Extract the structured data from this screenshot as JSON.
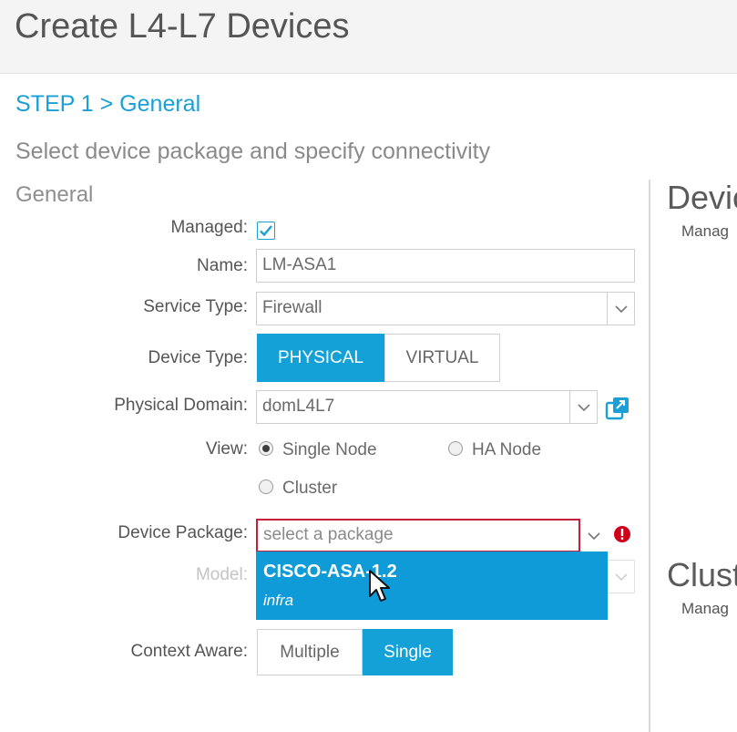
{
  "page": {
    "title": "Create L4-L7 Devices"
  },
  "wizard": {
    "step": "STEP 1 > General",
    "subtitle": "Select device package and specify connectivity",
    "section": "General"
  },
  "form": {
    "managed": {
      "label": "Managed:",
      "checked": true
    },
    "name": {
      "label": "Name:",
      "value": "LM-ASA1"
    },
    "service_type": {
      "label": "Service Type:",
      "value": "Firewall"
    },
    "device_type": {
      "label": "Device Type:",
      "options": [
        "PHYSICAL",
        "VIRTUAL"
      ],
      "selected": "PHYSICAL"
    },
    "physical_domain": {
      "label": "Physical Domain:",
      "value": "domL4L7"
    },
    "view": {
      "label": "View:",
      "options": [
        "Single Node",
        "HA Node",
        "Cluster"
      ],
      "selected": "Single Node"
    },
    "device_package": {
      "label": "Device Package:",
      "placeholder": "select a package",
      "dropdown_items": [
        {
          "name": "CISCO-ASA-1.2",
          "sub": "infra"
        }
      ]
    },
    "model": {
      "label": "Model:"
    },
    "context_aware": {
      "label": "Context Aware:",
      "options": [
        "Multiple",
        "Single"
      ],
      "selected": "Single"
    }
  },
  "right_panel": {
    "device_heading": "Devic",
    "device_sub": "Manag",
    "cluster_heading": "Clust",
    "cluster_sub": "Manag"
  },
  "colors": {
    "accent": "#13a1d8",
    "error": "#d0021b",
    "dropdown_bg": "#0f9bd7"
  }
}
